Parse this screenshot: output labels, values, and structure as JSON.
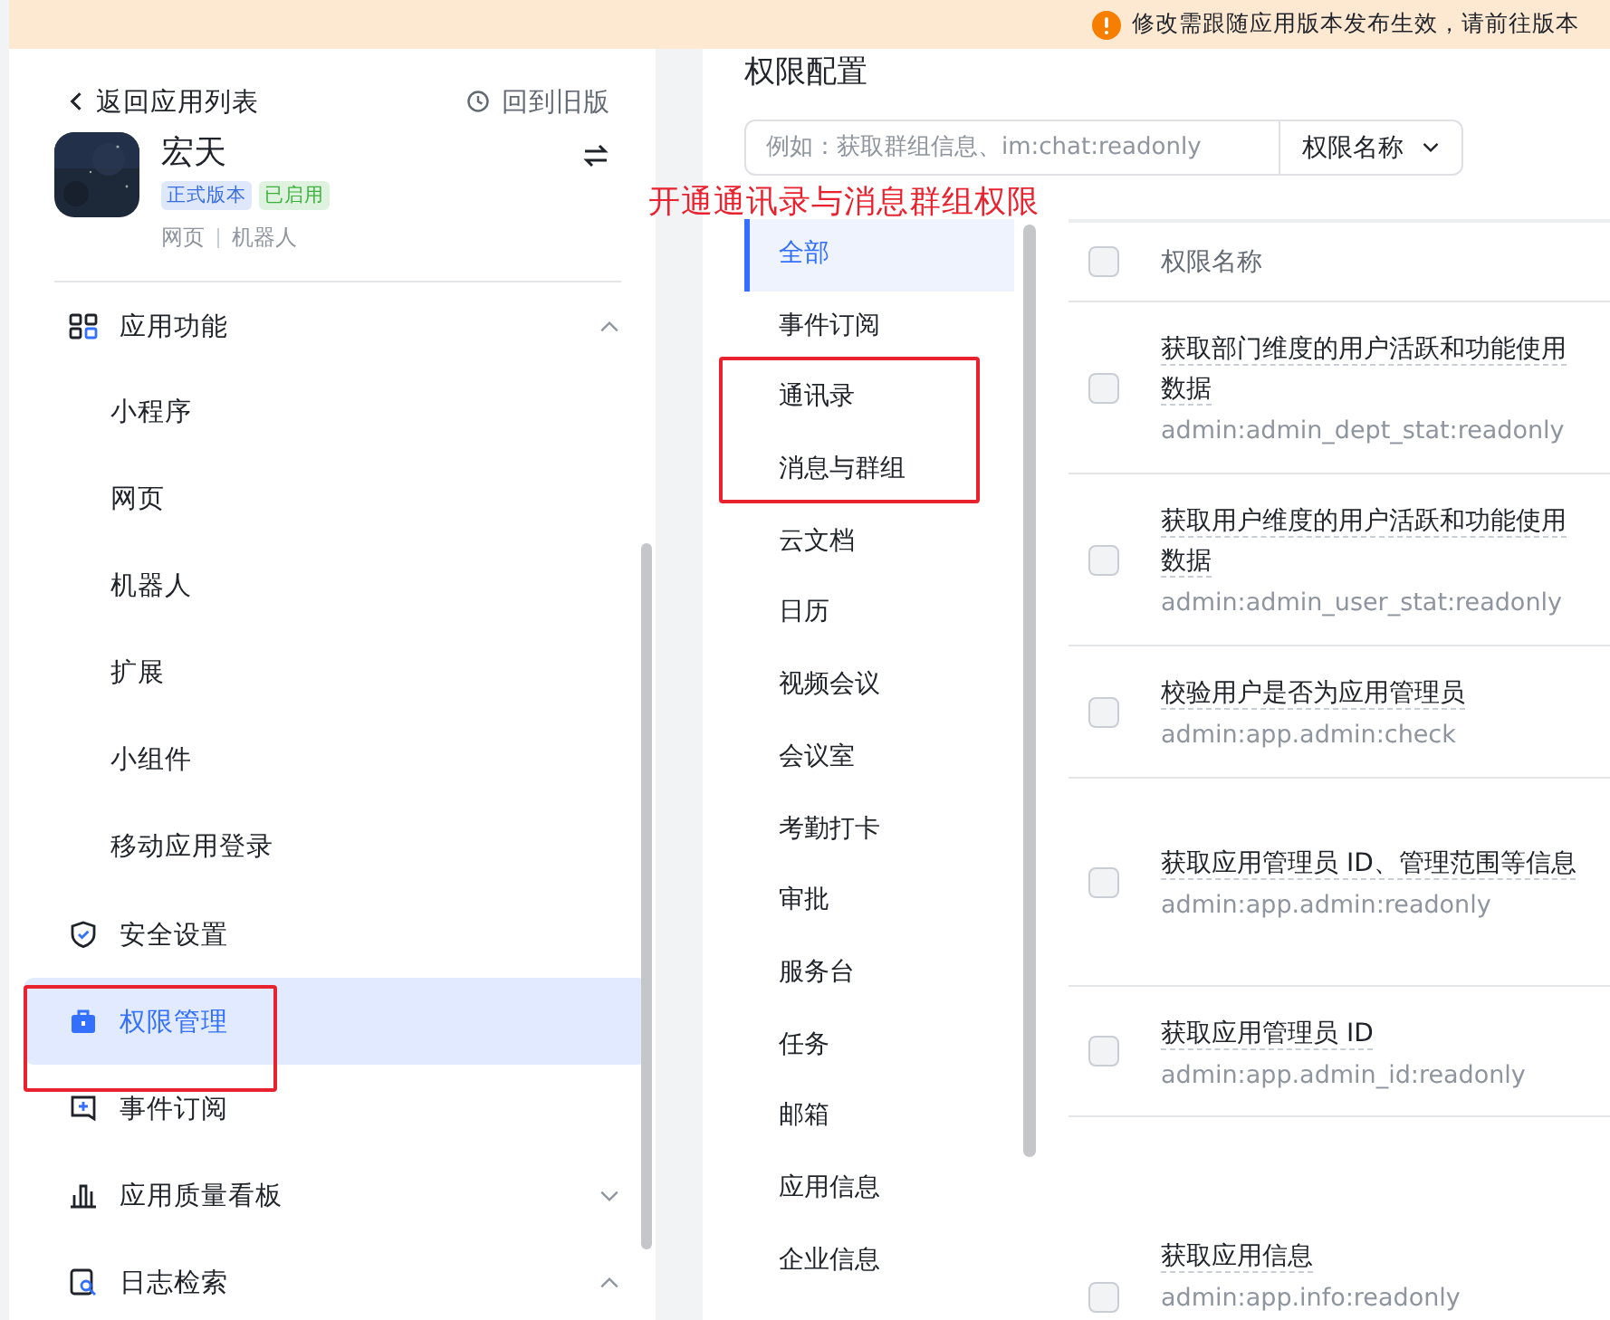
{
  "banner": {
    "text": "修改需跟随应用版本发布生效，请前往版本"
  },
  "sidebar": {
    "back_link": "返回应用列表",
    "old_version_link": "回到旧版",
    "app": {
      "name": "宏天",
      "tags": [
        {
          "label": "正式版本",
          "color": "#3a6fe0"
        },
        {
          "label": "已启用",
          "color": "#3bb33b"
        }
      ],
      "platforms": [
        "网页",
        "机器人"
      ]
    },
    "menu": [
      {
        "label": "应用功能",
        "expanded": true,
        "selected": false,
        "children": [
          {
            "label": "小程序"
          },
          {
            "label": "网页"
          },
          {
            "label": "机器人"
          },
          {
            "label": "扩展"
          },
          {
            "label": "小组件"
          },
          {
            "label": "移动应用登录"
          }
        ]
      },
      {
        "label": "安全设置",
        "selected": false
      },
      {
        "label": "权限管理",
        "selected": true
      },
      {
        "label": "事件订阅",
        "selected": false
      },
      {
        "label": "应用质量看板",
        "expanded": false,
        "selected": false
      },
      {
        "label": "日志检索",
        "expanded": true,
        "selected": false
      }
    ]
  },
  "main": {
    "title": "权限配置",
    "search": {
      "placeholder": "例如：获取群组信息、im:chat:readonly",
      "field": "权限名称"
    },
    "categories": [
      {
        "label": "全部",
        "selected": true
      },
      {
        "label": "事件订阅",
        "selected": false
      },
      {
        "label": "通讯录",
        "selected": false
      },
      {
        "label": "消息与群组",
        "selected": false
      },
      {
        "label": "云文档",
        "selected": false
      },
      {
        "label": "日历",
        "selected": false
      },
      {
        "label": "视频会议",
        "selected": false
      },
      {
        "label": "会议室",
        "selected": false
      },
      {
        "label": "考勤打卡",
        "selected": false
      },
      {
        "label": "审批",
        "selected": false
      },
      {
        "label": "服务台",
        "selected": false
      },
      {
        "label": "任务",
        "selected": false
      },
      {
        "label": "邮箱",
        "selected": false
      },
      {
        "label": "应用信息",
        "selected": false
      },
      {
        "label": "企业信息",
        "selected": false
      }
    ],
    "table": {
      "header": "权限名称",
      "header_checked": false,
      "rows": [
        {
          "name": "获取部门维度的用户活跃和功能使用数据",
          "scope": "admin:admin_dept_stat:readonly",
          "checked": false
        },
        {
          "name": "获取用户维度的用户活跃和功能使用数据",
          "scope": "admin:admin_user_stat:readonly",
          "checked": false
        },
        {
          "name": "校验用户是否为应用管理员",
          "scope": "admin:app.admin:check",
          "checked": false
        },
        {
          "name": "获取应用管理员 ID、管理范围等信息",
          "scope": "admin:app.admin:readonly",
          "checked": false
        },
        {
          "name": "获取应用管理员 ID",
          "scope": "admin:app.admin_id:readonly",
          "checked": false
        },
        {
          "name": "获取应用信息",
          "scope": "admin:app.info:readonly",
          "checked": false
        }
      ]
    }
  },
  "annotations": [
    {
      "kind": "callout",
      "text": "开通通讯录与消息群组权限"
    },
    {
      "kind": "box"
    },
    {
      "kind": "box"
    }
  ]
}
